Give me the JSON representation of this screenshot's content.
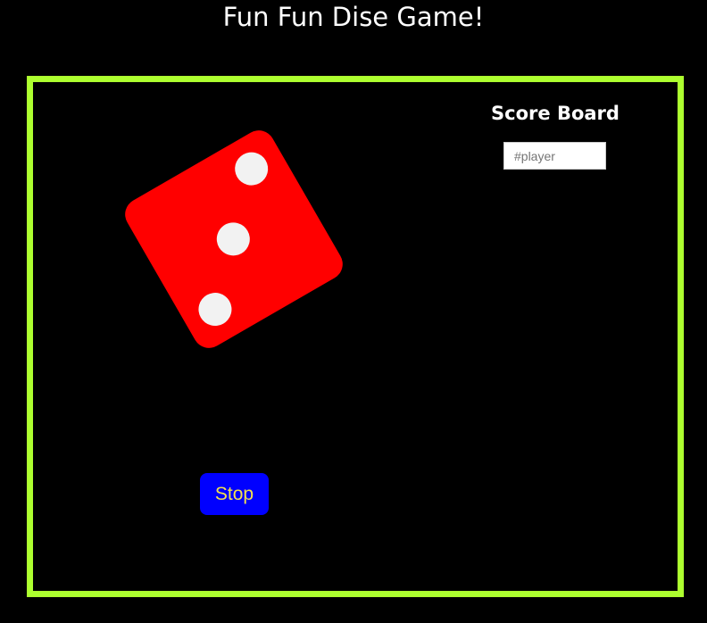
{
  "page": {
    "title": "Fun Fun Dise Game!"
  },
  "colors": {
    "background": "#000000",
    "board_border": "#adff2f",
    "die_face": "#ff0000",
    "die_pip": "#f2f2f2",
    "button_bg": "#0000ff",
    "button_text": "#f2e04f",
    "text": "#ffffff"
  },
  "die": {
    "face_value": 3
  },
  "scoreboard": {
    "title": "Score Board",
    "player_input": {
      "value": "",
      "placeholder": "#player"
    }
  },
  "controls": {
    "stop_label": "Stop"
  }
}
